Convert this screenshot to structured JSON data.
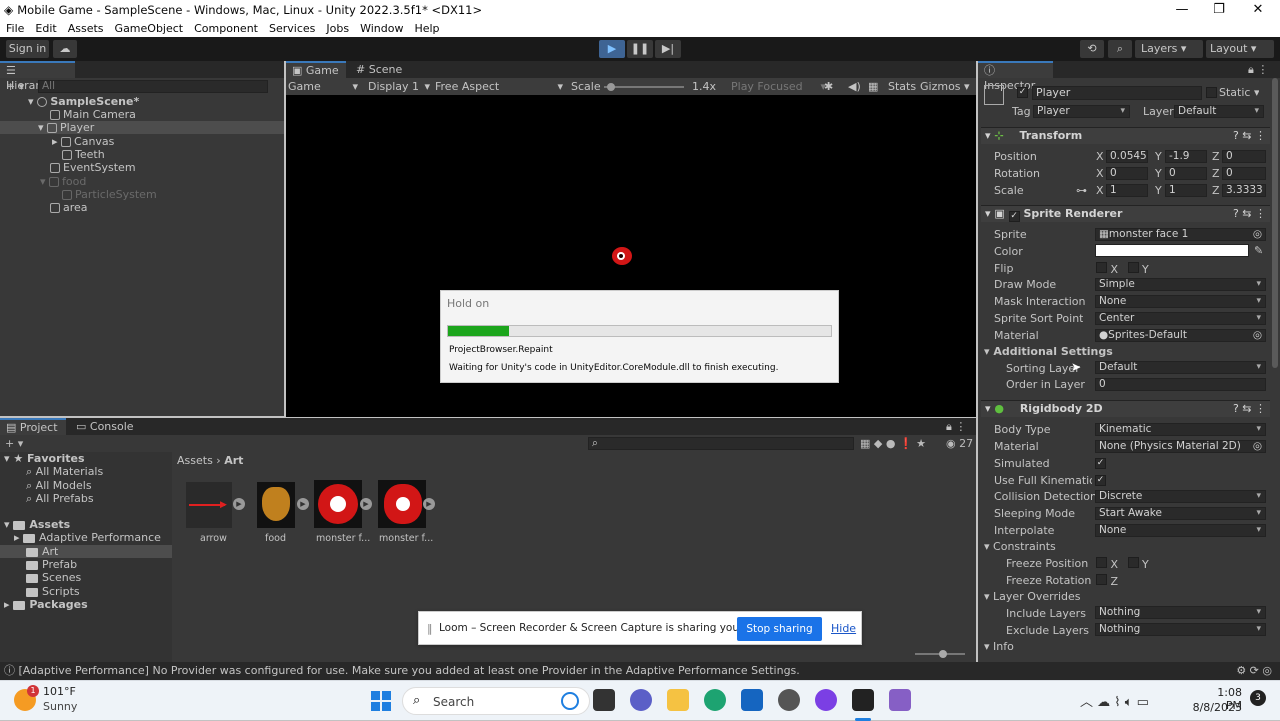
{
  "window": {
    "title": "Mobile Game - SampleScene - Windows, Mac, Linux - Unity 2022.3.5f1* <DX11>",
    "min": "—",
    "max": "❐",
    "close": "✕"
  },
  "menu": [
    "File",
    "Edit",
    "Assets",
    "GameObject",
    "Component",
    "Services",
    "Jobs",
    "Window",
    "Help"
  ],
  "toolbar": {
    "signin": "Sign in",
    "layers": "Layers",
    "layout": "Layout"
  },
  "hierarchy": {
    "tab": "Hierarchy",
    "search_placeholder": "All",
    "scene": "SampleScene*",
    "items": [
      "Main Camera",
      "Player",
      "Canvas",
      "Teeth",
      "EventSystem",
      "food",
      "ParticleSystem",
      "area"
    ]
  },
  "game": {
    "tabs": [
      "Game",
      "Scene"
    ],
    "mode": "Game",
    "display": "Display 1",
    "aspect": "Free Aspect",
    "scale_label": "Scale",
    "scale_value": "1.4x",
    "play_focused": "Play Focused",
    "stats": "Stats",
    "gizmos": "Gizmos"
  },
  "dialog": {
    "title": "Hold on",
    "progress": 0.16,
    "task": "ProjectBrowser.Repaint",
    "message": "Waiting for Unity's code in UnityEditor.CoreModule.dll to finish executing."
  },
  "project": {
    "tabs": [
      "Project",
      "Console"
    ],
    "hidden_count": "27",
    "favorites": "Favorites",
    "fav_items": [
      "All Materials",
      "All Models",
      "All Prefabs"
    ],
    "assets": "Assets",
    "asset_folders": [
      "Adaptive Performance",
      "Art",
      "Prefab",
      "Scenes",
      "Scripts"
    ],
    "packages": "Packages",
    "breadcrumb": [
      "Assets",
      "Art"
    ],
    "files": [
      "arrow",
      "food",
      "monster f...",
      "monster f..."
    ]
  },
  "share": {
    "text": "Loom – Screen Recorder & Screen Capture is sharing your screen.",
    "stop": "Stop sharing",
    "hide": "Hide"
  },
  "inspector": {
    "tab": "Inspector",
    "object_name": "Player",
    "static": "Static",
    "tag_label": "Tag",
    "tag": "Player",
    "layer_label": "Layer",
    "layer": "Default",
    "transform": {
      "title": "Transform",
      "rows": [
        {
          "label": "Position",
          "x": "0.0545",
          "y": "-1.9",
          "z": "0"
        },
        {
          "label": "Rotation",
          "x": "0",
          "y": "0",
          "z": "0"
        },
        {
          "label": "Scale",
          "x": "1",
          "y": "1",
          "z": "3.3333"
        }
      ]
    },
    "sprite_renderer": {
      "title": "Sprite Renderer",
      "rows": [
        {
          "label": "Sprite",
          "value": "monster face 1"
        },
        {
          "label": "Color",
          "value": ""
        },
        {
          "label": "Flip",
          "value": "X     Y"
        },
        {
          "label": "Draw Mode",
          "value": "Simple"
        },
        {
          "label": "Mask Interaction",
          "value": "None"
        },
        {
          "label": "Sprite Sort Point",
          "value": "Center"
        },
        {
          "label": "Material",
          "value": "Sprites-Default"
        }
      ],
      "additional": "Additional Settings",
      "sorting_layer_label": "Sorting Layer",
      "sorting_layer": "Default",
      "order_label": "Order in Layer",
      "order": "0"
    },
    "rigidbody": {
      "title": "Rigidbody 2D",
      "rows": [
        {
          "label": "Body Type",
          "value": "Kinematic"
        },
        {
          "label": "Material",
          "value": "None (Physics Material 2D)"
        },
        {
          "label": "Simulated",
          "value": "✓"
        },
        {
          "label": "Use Full Kinematic C",
          "value": "✓"
        },
        {
          "label": "Collision Detection",
          "value": "Discrete"
        },
        {
          "label": "Sleeping Mode",
          "value": "Start Awake"
        },
        {
          "label": "Interpolate",
          "value": "None"
        }
      ],
      "constraints": "Constraints",
      "freeze_pos": "Freeze Position",
      "freeze_pos_v": "X     Y",
      "freeze_rot": "Freeze Rotation",
      "freeze_rot_v": "Z",
      "overrides": "Layer Overrides",
      "include": "Include Layers",
      "include_v": "Nothing",
      "exclude": "Exclude Layers",
      "exclude_v": "Nothing",
      "info": "Info"
    }
  },
  "status": {
    "message": "[Adaptive Performance] No Provider was configured for use. Make sure you added at least one Provider in the Adaptive Performance Settings."
  },
  "taskbar": {
    "temp": "101°F",
    "weather": "Sunny",
    "badge": "1",
    "search": "Search",
    "time": "1:08 PM",
    "date": "8/8/2023",
    "notif": "3"
  },
  "colors": {
    "accent": "#3a79bb",
    "progress": "#1ca51c",
    "share_btn": "#1a73e8"
  }
}
